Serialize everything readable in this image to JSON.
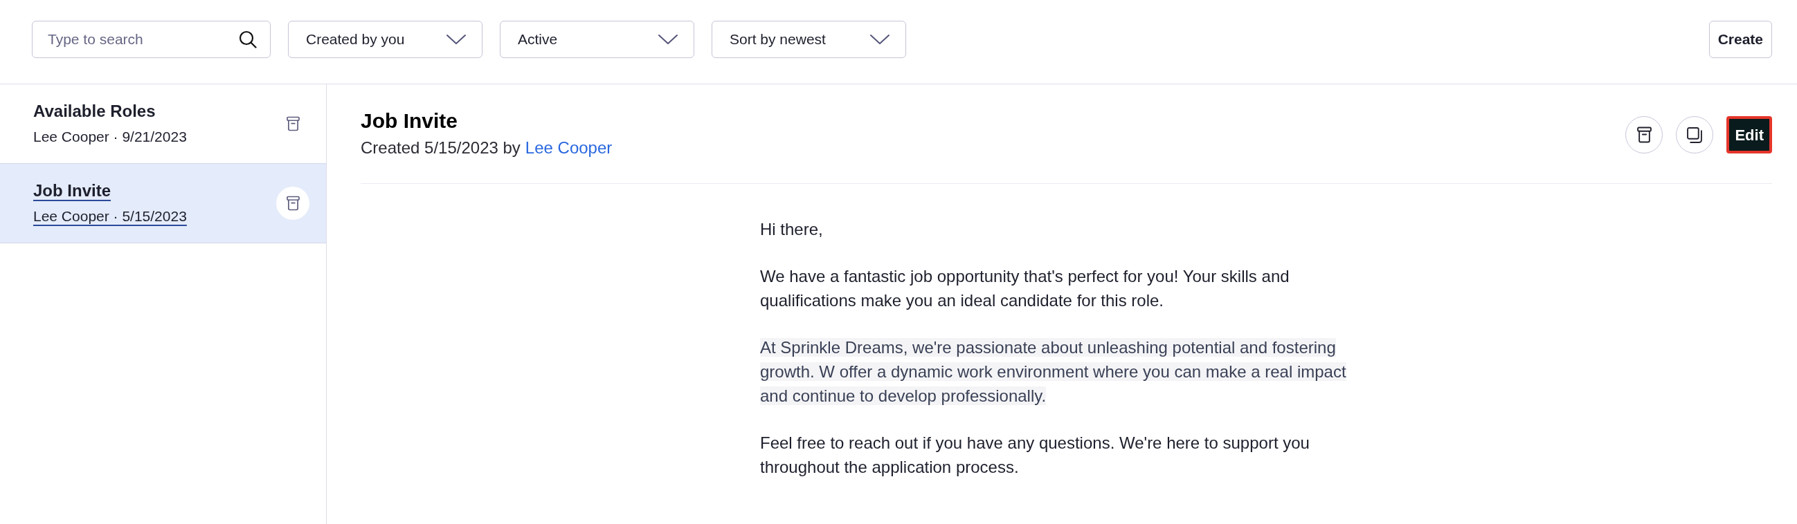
{
  "toolbar": {
    "search": {
      "placeholder": "Type to search"
    },
    "filters": [
      {
        "label": "Created by you"
      },
      {
        "label": "Active"
      },
      {
        "label": "Sort by newest"
      }
    ],
    "create_button": "Create"
  },
  "sidebar": {
    "items": [
      {
        "title": "Available Roles",
        "meta": "Lee Cooper · 9/21/2023",
        "selected": false
      },
      {
        "title": "Job Invite",
        "meta": "Lee Cooper · 5/15/2023",
        "selected": true
      }
    ]
  },
  "detail": {
    "title": "Job Invite",
    "created": "Created 5/15/2023 by",
    "author": "Lee Cooper",
    "edit_button": "Edit",
    "paragraphs": [
      {
        "text": "Hi there,",
        "highlighted": false
      },
      {
        "text": "We have a fantastic job opportunity that's perfect for you! Your skills and qualifications make you an ideal candidate for this role.",
        "highlighted": false
      },
      {
        "text": "At Sprinkle Dreams, we're passionate about unleashing potential and fostering growth. W offer a dynamic work environment where you can make a real impact and continue to develop professionally.",
        "highlighted": true
      },
      {
        "text": "Feel free to reach out if you have any questions. We're here to support you throughout the application process.",
        "highlighted": false
      }
    ]
  }
}
